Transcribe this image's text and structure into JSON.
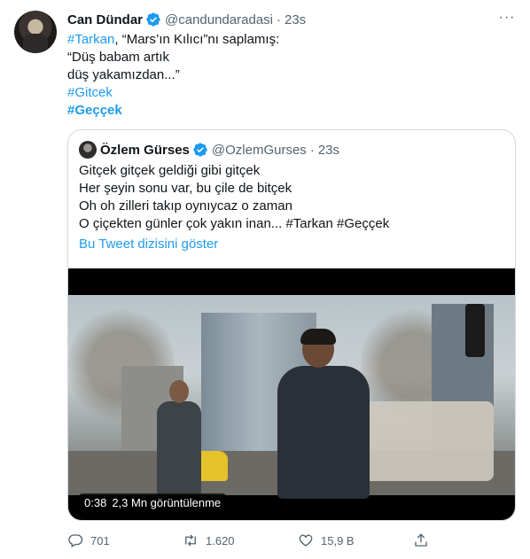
{
  "tweet": {
    "author_name": "Can Dündar",
    "handle": "@candundaradasi",
    "separator": "·",
    "time": "23s",
    "more_label": "···",
    "lines": [
      {
        "tag": "#Tarkan",
        "rest": ", “Mars’ın Kılıcı”nı saplamış:"
      },
      {
        "text": "“Düş babam artık"
      },
      {
        "text": "düş yakamızdan...”"
      },
      {
        "tag": "#Gitcek"
      },
      {
        "tag": "#Geççek"
      }
    ]
  },
  "quote": {
    "author_name": "Özlem Gürses",
    "handle": "@OzlemGurses",
    "separator": "·",
    "time": "23s",
    "lines": [
      "Gitçek gitçek geldiği gibi gitçek",
      "Her şeyin sonu var, bu çile de bitçek",
      "Oh oh zilleri takıp oynıycaz o zaman"
    ],
    "last_line_text": "O çiçekten günler çok yakın inan... ",
    "last_line_tag1": "#Tarkan",
    "last_line_tag2": "#Geççek",
    "show_thread": "Bu Tweet dizisini göster",
    "video": {
      "duration": "0:38",
      "views": "2,3 Mn görüntülenme"
    }
  },
  "actions": {
    "reply_count": "701",
    "retweet_count": "1.620",
    "like_count": "15,9 B"
  },
  "colors": {
    "accent": "#1d9bf0",
    "secondary_text": "#536471",
    "border": "#cfd9de"
  },
  "icons": {
    "verified": "verified-badge-icon",
    "more": "more-horizontal-icon",
    "reply": "reply-icon",
    "retweet": "retweet-icon",
    "like": "heart-icon",
    "share": "share-icon"
  }
}
